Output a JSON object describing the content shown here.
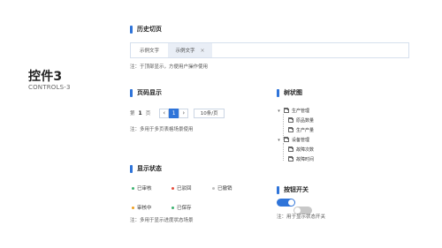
{
  "title": {
    "main": "控件3",
    "sub": "CONTROLS-3"
  },
  "history": {
    "heading": "历史切页",
    "tabs": [
      {
        "label": "示例文字"
      },
      {
        "label": "示例文字",
        "close": "×"
      }
    ],
    "note": "注：于顶部显示，方便用户操作使用"
  },
  "pagination": {
    "heading": "页码显示",
    "prefix": "第",
    "page": "1",
    "suffix": "页",
    "prev_icon": "‹",
    "current": "1",
    "next_icon": "›",
    "page_size": "10条/页",
    "note": "注：多用于多页表格场景使用"
  },
  "status": {
    "heading": "显示状态",
    "items": [
      {
        "label": "已审核",
        "color": "#3cb371"
      },
      {
        "label": "已驳回",
        "color": "#e74c3c"
      },
      {
        "label": "已撤销",
        "color": "#bfbfbf"
      },
      {
        "label": "审核中",
        "color": "#f0a020"
      },
      {
        "label": "已保存",
        "color": "#3cb371"
      }
    ],
    "note": "注：多用于显示进度状态场景"
  },
  "tree": {
    "heading": "树状图",
    "nodes": [
      {
        "label": "生产管理",
        "chev": "▾"
      },
      {
        "label": "原品数量"
      },
      {
        "label": "生产产量"
      },
      {
        "label": "设备管理",
        "chev": "▾"
      },
      {
        "label": "故障次数"
      },
      {
        "label": "故障时间"
      }
    ]
  },
  "switch": {
    "heading": "按钮开关",
    "on_color": "#2f74d9",
    "off_color": "#c8c8c8",
    "note": "注：用于显示状态开关"
  }
}
